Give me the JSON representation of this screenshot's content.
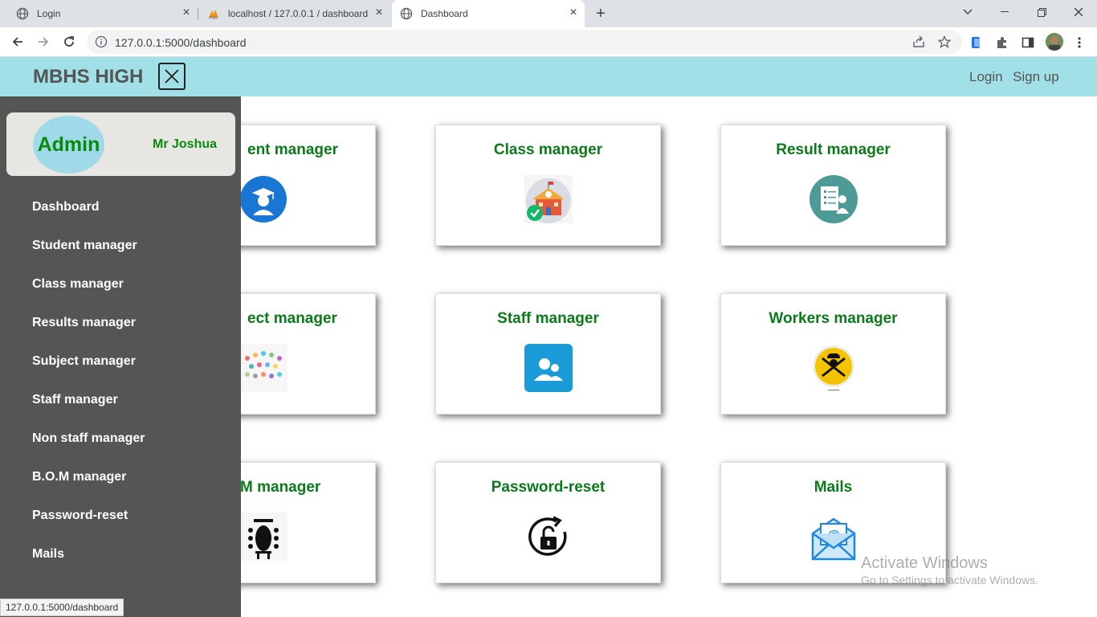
{
  "browser": {
    "tabs": [
      {
        "title": "Login"
      },
      {
        "title": "localhost / 127.0.0.1 / dashboard"
      },
      {
        "title": "Dashboard"
      }
    ],
    "address": "127.0.0.1:5000/dashboard",
    "status_url": "127.0.0.1:5000/dashboard"
  },
  "header": {
    "brand": "MBHS HIGH",
    "login": "Login",
    "signup": "Sign up",
    "bg_color": "#a0e0e6"
  },
  "sidebar": {
    "avatar_label": "Admin",
    "user_name": "Mr Joshua",
    "items": [
      {
        "label": "Dashboard"
      },
      {
        "label": "Student manager"
      },
      {
        "label": "Class manager"
      },
      {
        "label": "Results manager"
      },
      {
        "label": "Subject manager"
      },
      {
        "label": "Staff manager"
      },
      {
        "label": "Non staff manager"
      },
      {
        "label": "B.O.M manager"
      },
      {
        "label": "Password-reset"
      },
      {
        "label": "Mails"
      }
    ]
  },
  "cards": [
    {
      "title": "ent manager",
      "icon": "student-icon"
    },
    {
      "title": "Class manager",
      "icon": "school-building-icon"
    },
    {
      "title": "Result manager",
      "icon": "result-sheet-icon"
    },
    {
      "title": "ect manager",
      "icon": "subjects-icon"
    },
    {
      "title": "Staff manager",
      "icon": "staff-icon"
    },
    {
      "title": "Workers manager",
      "icon": "chef-icon"
    },
    {
      "title": "M manager",
      "icon": "board-meeting-icon"
    },
    {
      "title": "Password-reset",
      "icon": "unlock-reset-icon"
    },
    {
      "title": "Mails",
      "icon": "mail-icon"
    }
  ],
  "watermark": {
    "line1": "Activate Windows",
    "line2": "Go to Settings to activate Windows."
  }
}
